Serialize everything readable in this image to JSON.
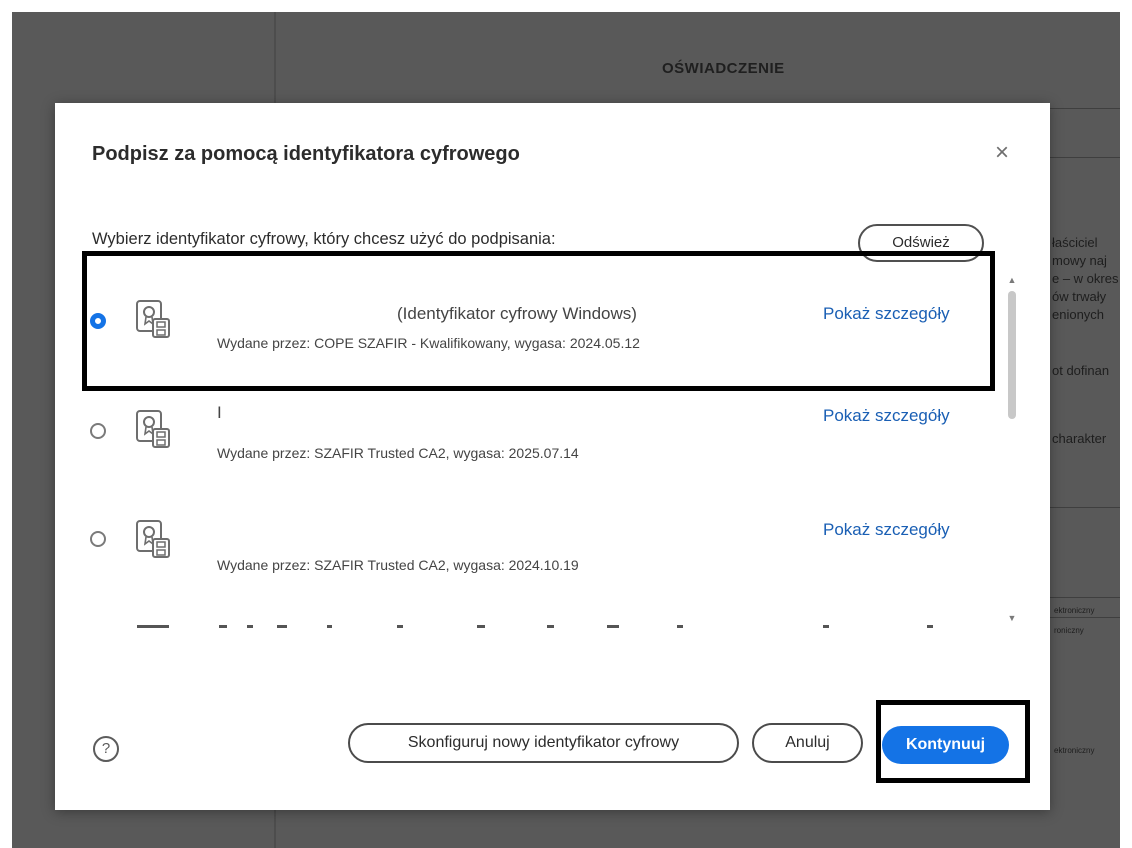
{
  "background_document": {
    "title": "OŚWIADCZENIE",
    "side_texts": [
      "łaściciel",
      "mowy naj",
      "e – w okres",
      "ów trwały",
      "enionych",
      "ot dofinan",
      "charakter",
      "ektroniczny",
      "roniczny",
      "ektroniczny"
    ]
  },
  "dialog": {
    "title": "Podpisz za pomocą identyfikatora cyfrowego",
    "prompt": "Wybierz identyfikator cyfrowy, który chcesz użyć do podpisania:",
    "refresh_label": "Odśwież",
    "identities": [
      {
        "name": "(Identyfikator cyfrowy Windows)",
        "issuer": "Wydane przez: COPE SZAFIR - Kwalifikowany, wygasa: 2024.05.12",
        "details_label": "Pokaż szczegóły",
        "selected": true
      },
      {
        "name": "I",
        "issuer": "Wydane przez: SZAFIR Trusted CA2, wygasa: 2025.07.14",
        "details_label": "Pokaż szczegóły",
        "selected": false
      },
      {
        "name": "",
        "issuer": "Wydane przez: SZAFIR Trusted CA2, wygasa: 2024.10.19",
        "details_label": "Pokaż szczegóły",
        "selected": false
      }
    ],
    "help_label": "?",
    "configure_label": "Skonfiguruj nowy identyfikator cyfrowy",
    "cancel_label": "Anuluj",
    "continue_label": "Kontynuuj"
  },
  "colors": {
    "accent": "#1473e6",
    "link": "#1a5fb4",
    "backdrop": "#595959"
  },
  "icons": {
    "close": "close-icon",
    "certificate": "certificate-icon",
    "help": "help-icon",
    "scroll_up": "scroll-up-icon",
    "scroll_down": "scroll-down-icon"
  }
}
